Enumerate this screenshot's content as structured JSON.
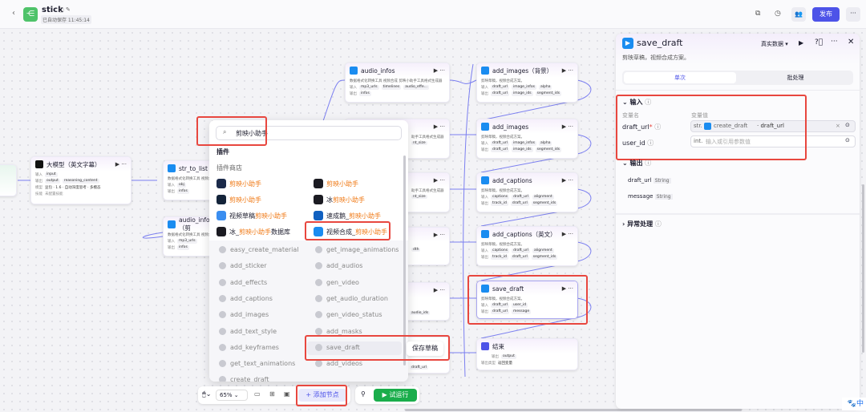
{
  "header": {
    "title": "stick",
    "save_status": "已自动保存 11:45:14",
    "publish_label": "发布"
  },
  "nodes": {
    "llm": {
      "title": "大模型（英文字幕）",
      "in_label": "输入",
      "input": "input",
      "out_label": "输出",
      "outputs": [
        "output",
        "reasoning_content"
      ],
      "model_label": "模型",
      "model": "豆包 · 1.6 · 自动深度思考 · 多模态",
      "skill_label": "技能",
      "skill": "未配置技能"
    },
    "str_to_list": {
      "title": "str_to_list",
      "desc": "数据格式化转换工具 视频合成",
      "in_label": "输入",
      "input": "obj",
      "out_label": "输出",
      "output": "infos"
    },
    "audio_infos_left": {
      "title": "audio_infos（剪",
      "desc": "数据格式化转换工具 视频合成",
      "in_label": "输入",
      "input": "mp3_urls",
      "out_label": "输出",
      "output": "infos"
    },
    "audio_infos": {
      "title": "audio_infos",
      "desc": "数据格式化转换工具 视频合成 剪映小助手工具格式生成器",
      "in_label": "输入",
      "inputs": [
        "mp3_urls",
        "timelines",
        "audio_effe..."
      ],
      "out_label": "输出",
      "output": "infos"
    },
    "mid2": {
      "desc": "助手工具格式生成器",
      "tag": "nt_size"
    },
    "mid3": {
      "desc": "助手工具格式生成器",
      "tag": "nt_size"
    },
    "mid4": {
      "tag": "dth"
    },
    "mid5": {
      "tag": "audio_ids"
    },
    "mid6": {
      "tag": "draft_url"
    },
    "add_images_bg": {
      "title": "add_images（背景）",
      "desc": "剪映草稿，视频合成方案。",
      "in_label": "输入",
      "inputs": [
        "draft_url",
        "image_infos",
        "alpha"
      ],
      "out_label": "输出",
      "outputs": [
        "draft_url",
        "image_ids",
        "segment_ids"
      ]
    },
    "add_images": {
      "title": "add_images",
      "desc": "剪映草稿，视频合成方案。",
      "in_label": "输入",
      "inputs": [
        "draft_url",
        "image_infos",
        "alpha"
      ],
      "out_label": "输出",
      "outputs": [
        "draft_url",
        "image_ids",
        "segment_ids"
      ]
    },
    "add_captions": {
      "title": "add_captions",
      "desc": "剪映草稿，视频合成方案。",
      "in_label": "输入",
      "inputs": [
        "captions",
        "draft_url",
        "alignment"
      ],
      "out_label": "输出",
      "outputs": [
        "track_id",
        "draft_url",
        "segment_ids"
      ]
    },
    "add_captions_en": {
      "title": "add_captions（英文）",
      "desc": "剪映草稿，视频合成方案。",
      "in_label": "输入",
      "inputs": [
        "captions",
        "draft_url",
        "alignment"
      ],
      "out_label": "输出",
      "outputs": [
        "track_id",
        "draft_url",
        "segment_ids"
      ]
    },
    "save_draft": {
      "title": "save_draft",
      "desc": "剪映草稿，视频合成方案。",
      "in_label": "输入",
      "inputs": [
        "draft_url",
        "user_id"
      ],
      "out_label": "输出",
      "outputs": [
        "draft_url",
        "message"
      ]
    },
    "end": {
      "title": "结束",
      "out_label": "输出",
      "output": "output",
      "type_label": "输出类型",
      "type": "返回变量"
    }
  },
  "popup": {
    "search_value": "剪映小助手",
    "section": "插件",
    "subsection": "插件商店",
    "plugins": [
      {
        "pre": "",
        "hl": "剪映小助手",
        "post": ""
      },
      {
        "pre": "",
        "hl": "剪映小助手",
        "post": ""
      },
      {
        "pre": "",
        "hl": "剪映小助手",
        "post": ""
      },
      {
        "pre": "冰",
        "hl": "剪映小助手",
        "post": ""
      },
      {
        "pre": "视频草稿",
        "hl": "剪映小助手",
        "post": ""
      },
      {
        "pre": "速成鹅_",
        "hl": "剪映小助手",
        "post": ""
      },
      {
        "pre": "冰_",
        "hl": "剪映小助手",
        "post": "数据库"
      },
      {
        "pre": "视频合成_",
        "hl": "剪映小助手",
        "post": ""
      }
    ],
    "tools_left": [
      "easy_create_material",
      "add_sticker",
      "add_effects",
      "add_captions",
      "add_images",
      "add_text_style",
      "add_keyframes",
      "get_text_animations",
      "create_draft"
    ],
    "tools_right": [
      "get_image_animations",
      "add_audios",
      "gen_video",
      "get_audio_duration",
      "gen_video_status",
      "add_masks",
      "save_draft",
      "add_videos"
    ],
    "tooltip": "保存草稿"
  },
  "toolbar": {
    "zoom": "65%",
    "add_node": "添加节点",
    "test_run": "试运行"
  },
  "panel": {
    "title": "save_draft",
    "desc": "剪映草稿，视频合成方案。",
    "data_mode": "真实数据",
    "tabs": [
      "单次",
      "批处理"
    ],
    "active_tab": 0,
    "input": {
      "title": "输入",
      "col_name": "变量名",
      "col_value": "变量值",
      "rows": [
        {
          "name": "draft_url",
          "required": true,
          "type": "str.",
          "ref_node": "create_draft",
          "ref_field": "draft_url",
          "placeholder": ""
        },
        {
          "name": "user_id",
          "required": false,
          "type": "int.",
          "placeholder": "输入或引用参数值"
        }
      ]
    },
    "output": {
      "title": "输出",
      "rows": [
        {
          "name": "draft_url",
          "type": "String"
        },
        {
          "name": "message",
          "type": "String"
        }
      ]
    },
    "error": {
      "title": "异常处理"
    }
  },
  "ime": {
    "label": "中"
  },
  "colors": {
    "accent": "#4d53e8",
    "highlight": "#f07a16",
    "annotation": "#e8473f",
    "run": "#1aad4b"
  }
}
